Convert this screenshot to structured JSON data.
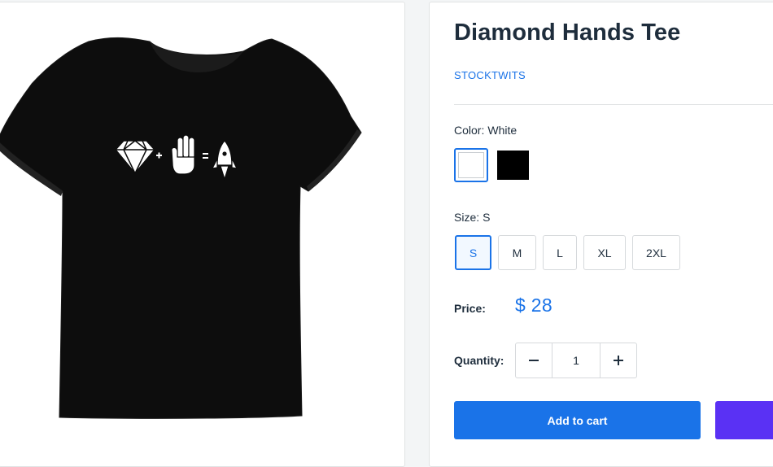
{
  "product": {
    "title": "Diamond Hands Tee",
    "vendor": "STOCKTWITS",
    "image_icon": "tshirt-diamond-hand-rocket-graphic"
  },
  "color": {
    "label": "Color:",
    "selected": "White",
    "swatches": [
      {
        "name": "White",
        "hex": "#ffffff",
        "selected": true
      },
      {
        "name": "Black",
        "hex": "#000000",
        "selected": false
      }
    ]
  },
  "size": {
    "label": "Size:",
    "selected": "S",
    "options": [
      "S",
      "M",
      "L",
      "XL",
      "2XL"
    ]
  },
  "price": {
    "label": "Price:",
    "value": "$ 28"
  },
  "quantity": {
    "label": "Quantity:",
    "value": "1",
    "decrease_icon": "minus-icon",
    "increase_icon": "plus-icon"
  },
  "actions": {
    "add_to_cart": "Add to cart",
    "buy_now_color": "#5a31f4"
  },
  "colors": {
    "accent": "#1a73e8",
    "text": "#1e2d3c"
  }
}
